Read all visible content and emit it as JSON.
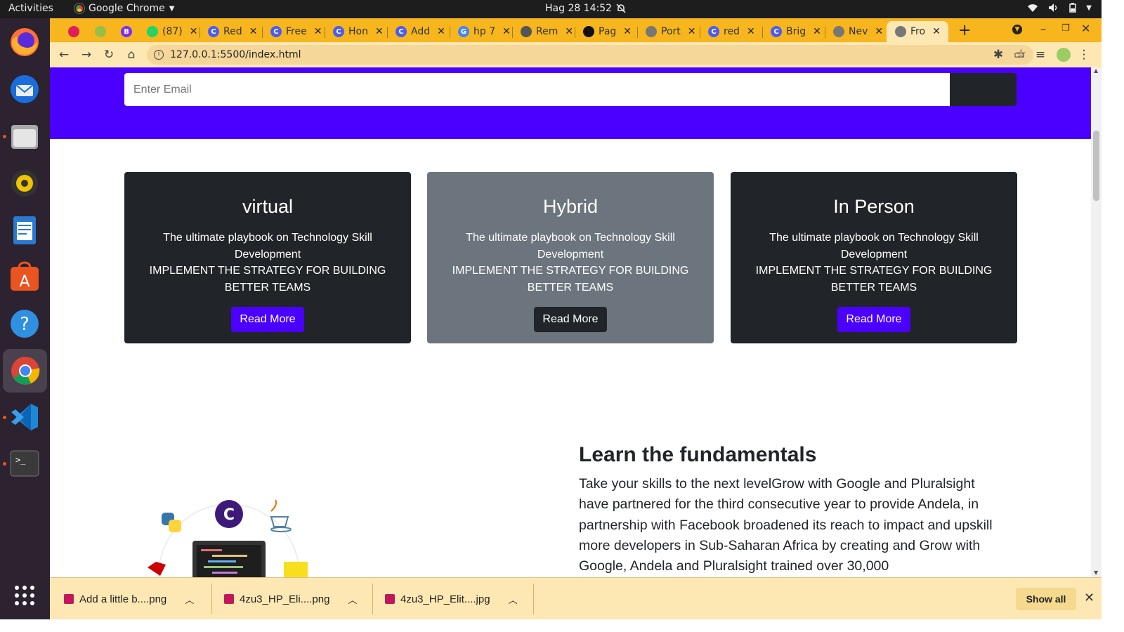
{
  "topbar": {
    "activities": "Activities",
    "app_name": "Google Chrome",
    "clock": "Hag 28  14:52"
  },
  "dock": {
    "items": [
      "firefox-icon",
      "thunderbird-icon",
      "files-icon",
      "rhythmbox-icon",
      "writer-icon",
      "software-icon",
      "help-icon",
      "chrome-icon",
      "vscode-icon",
      "terminal-icon",
      "apps-grid-icon"
    ]
  },
  "tabs": [
    {
      "label": "",
      "fav_color": "#e01e5a",
      "fav": "slack-icon"
    },
    {
      "label": "",
      "fav_color": "#95bf47",
      "fav": "shopify-icon"
    },
    {
      "label": "",
      "fav_color": "#7b2ff7",
      "fav": "b-icon",
      "fav_text": "B"
    },
    {
      "label": "(87)",
      "fav_color": "#25d366",
      "fav": "whatsapp-icon"
    },
    {
      "label": "Red",
      "fav_color": "#4b5cf0",
      "fav": "canva-icon",
      "fav_text": "C"
    },
    {
      "label": "Free",
      "fav_color": "#4b5cf0",
      "fav": "canva-icon",
      "fav_text": "C"
    },
    {
      "label": "Hon",
      "fav_color": "#4b5cf0",
      "fav": "canva-icon",
      "fav_text": "C"
    },
    {
      "label": "Add",
      "fav_color": "#4b5cf0",
      "fav": "canva-icon",
      "fav_text": "C"
    },
    {
      "label": "hp 7",
      "fav_color": "#4285f4",
      "fav": "google-icon",
      "fav_text": "G"
    },
    {
      "label": "Rem",
      "fav_color": "#555555",
      "fav": "remove-icon"
    },
    {
      "label": "Pag",
      "fav_color": "#111111",
      "fav": "github-icon"
    },
    {
      "label": "Port",
      "fav_color": "#777777",
      "fav": "globe-icon"
    },
    {
      "label": "red",
      "fav_color": "#4b5cf0",
      "fav": "canva-icon",
      "fav_text": "C"
    },
    {
      "label": "Brig",
      "fav_color": "#4b5cf0",
      "fav": "canva-icon",
      "fav_text": "C"
    },
    {
      "label": "Nev",
      "fav_color": "#777777",
      "fav": "globe-icon"
    },
    {
      "label": "Fro",
      "fav_color": "#777777",
      "fav": "globe-icon",
      "active": true
    }
  ],
  "toolbar": {
    "url": "127.0.0.1:5500/index.html"
  },
  "page": {
    "email_placeholder": "Enter Email",
    "cards": [
      {
        "title": "virtual",
        "line1": "The ultimate playbook on Technology Skill Development",
        "line2": "IMPLEMENT THE STRATEGY FOR BUILDING BETTER TEAMS",
        "button": "Read More",
        "style": "dark"
      },
      {
        "title": "Hybrid",
        "line1": "The ultimate playbook on Technology Skill Development",
        "line2": "IMPLEMENT THE STRATEGY FOR BUILDING BETTER TEAMS",
        "button": "Read More",
        "style": "gray"
      },
      {
        "title": "In Person",
        "line1": "The ultimate playbook on Technology Skill Development",
        "line2": "IMPLEMENT THE STRATEGY FOR BUILDING BETTER TEAMS",
        "button": "Read More",
        "style": "dark"
      }
    ],
    "fundamentals": {
      "title": "Learn the fundamentals",
      "text": "Take your skills to the next levelGrow with Google and Pluralsight have partnered for the third consecutive year to provide Andela, in partnership with Facebook broadened its reach to impact and upskill more developers in Sub-Saharan Africa by creating and Grow with Google, Andela and Pluralsight trained over 30,000"
    }
  },
  "downloads": {
    "items": [
      "Add a little b....png",
      "4zu3_HP_Eli....png",
      "4zu3_HP_Elit....jpg"
    ],
    "show_all": "Show all"
  },
  "colors": {
    "brand": "#4b00ff",
    "tab_strip": "#f7b51e",
    "toolbar": "#fde7b3",
    "card_dark": "#212529",
    "card_gray": "#6c757d"
  }
}
